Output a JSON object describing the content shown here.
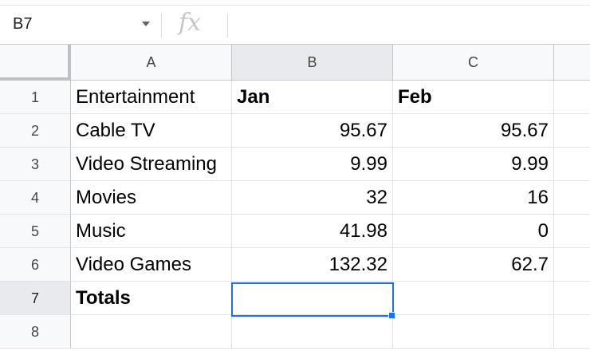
{
  "namebox": {
    "value": "B7"
  },
  "formula": {
    "icon": "fx",
    "value": ""
  },
  "columns": [
    "A",
    "B",
    "C"
  ],
  "rows": [
    "1",
    "2",
    "3",
    "4",
    "5",
    "6",
    "7",
    "8"
  ],
  "cells": {
    "A1": "Entertainment",
    "B1": "Jan",
    "C1": "Feb",
    "A2": "Cable TV",
    "B2": "95.67",
    "C2": "95.67",
    "A3": "Video Streaming",
    "B3": "9.99",
    "C3": "9.99",
    "A4": "Movies",
    "B4": "32",
    "C4": "16",
    "A5": "Music",
    "B5": "41.98",
    "C5": "0",
    "A6": "Video Games",
    "B6": "132.32",
    "C6": "62.7",
    "A7": "Totals",
    "B7": "",
    "C7": "",
    "A8": "",
    "B8": "",
    "C8": ""
  },
  "selected_cell": "B7",
  "colors": {
    "selection": "#1a73e8",
    "gridline": "#e1e3e6"
  }
}
